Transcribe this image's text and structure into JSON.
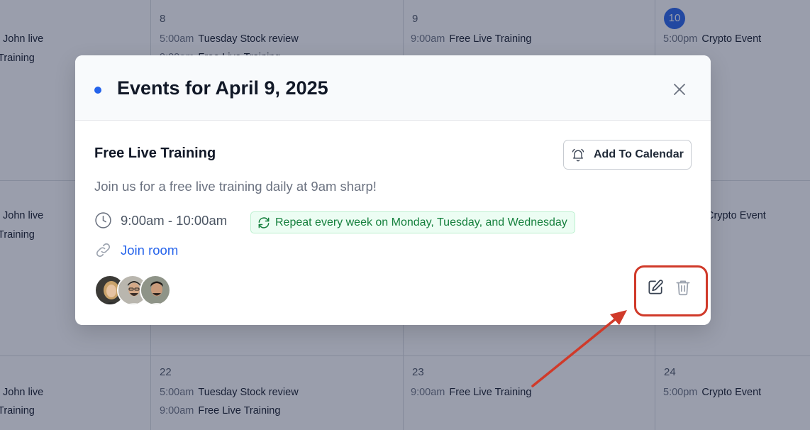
{
  "calendar": {
    "rows": [
      {
        "cells": [
          {
            "day": "",
            "events": [
              {
                "time": "",
                "title": "John live"
              },
              {
                "time": "",
                "title": "Training"
              }
            ]
          },
          {
            "day": "8",
            "events": [
              {
                "time": "5:00am",
                "title": "Tuesday Stock review"
              },
              {
                "time": "9:00am",
                "title": "Free Live Training"
              }
            ]
          },
          {
            "day": "9",
            "events": [
              {
                "time": "9:00am",
                "title": "Free Live Training"
              }
            ]
          },
          {
            "day": "10",
            "today": true,
            "events": [
              {
                "time": "5:00pm",
                "title": "Crypto Event"
              }
            ]
          }
        ]
      },
      {
        "cells": [
          {
            "day": "",
            "events": [
              {
                "time": "",
                "title": "John live"
              },
              {
                "time": "",
                "title": "Training"
              }
            ]
          },
          {
            "day": "",
            "events": []
          },
          {
            "day": "",
            "events": []
          },
          {
            "day": "",
            "events": [
              {
                "time": "",
                "title": "Crypto Event"
              }
            ]
          }
        ]
      },
      {
        "cells": [
          {
            "day": "",
            "events": [
              {
                "time": "",
                "title": "John live"
              },
              {
                "time": "",
                "title": "Training"
              }
            ]
          },
          {
            "day": "22",
            "events": [
              {
                "time": "5:00am",
                "title": "Tuesday Stock review"
              },
              {
                "time": "9:00am",
                "title": "Free Live Training"
              }
            ]
          },
          {
            "day": "23",
            "events": [
              {
                "time": "9:00am",
                "title": "Free Live Training"
              }
            ]
          },
          {
            "day": "24",
            "events": [
              {
                "time": "5:00pm",
                "title": "Crypto Event"
              }
            ]
          }
        ]
      }
    ]
  },
  "modal": {
    "title": "Events for April 9, 2025",
    "event": {
      "title": "Free Live Training",
      "add_to_calendar_label": "Add To Calendar",
      "description": "Join us for a free live training daily at 9am sharp!",
      "time_range": "9:00am - 10:00am",
      "repeat": "Repeat every week on Monday, Tuesday, and Wednesday",
      "join_label": "Join room",
      "attendee_count": 3
    },
    "icons": {
      "close": "close-icon",
      "bell": "bell-icon",
      "clock": "clock-icon",
      "repeat": "refresh-icon",
      "link": "link-icon",
      "edit": "edit-icon",
      "delete": "trash-icon"
    }
  },
  "colors": {
    "accent": "#2563eb",
    "repeat_green": "#15803d",
    "annotation_red": "#d03a2a"
  }
}
